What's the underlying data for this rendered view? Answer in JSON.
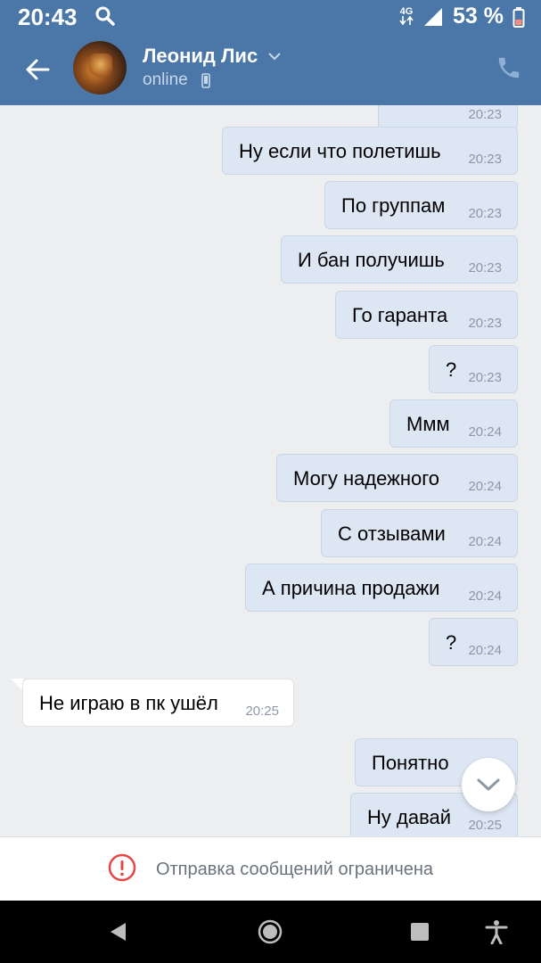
{
  "status_bar": {
    "time": "20:43",
    "network": "4G",
    "battery": "53 %"
  },
  "header": {
    "contact_name": "Леонид Лис",
    "contact_status": "online"
  },
  "messages": [
    {
      "direction": "out",
      "text": "",
      "time": "20:23"
    },
    {
      "direction": "out",
      "text": "Ну если что полетишь",
      "time": "20:23"
    },
    {
      "direction": "out",
      "text": "По группам",
      "time": "20:23"
    },
    {
      "direction": "out",
      "text": "И бан получишь",
      "time": "20:23"
    },
    {
      "direction": "out",
      "text": "Го гаранта",
      "time": "20:23"
    },
    {
      "direction": "out",
      "text": "?",
      "time": "20:23"
    },
    {
      "direction": "out",
      "text": "Ммм",
      "time": "20:24"
    },
    {
      "direction": "out",
      "text": "Могу надежного",
      "time": "20:24"
    },
    {
      "direction": "out",
      "text": "С отзывами",
      "time": "20:24"
    },
    {
      "direction": "out",
      "text": "А причина продажи",
      "time": "20:24"
    },
    {
      "direction": "out",
      "text": "?",
      "time": "20:24"
    },
    {
      "direction": "in",
      "text": "Не играю в пк ушёл",
      "time": "20:25"
    },
    {
      "direction": "out",
      "text": "Понятно",
      "time": ""
    },
    {
      "direction": "out",
      "text": "Ну давай",
      "time": "20:25"
    }
  ],
  "restricted_notice": "Отправка сообщений ограничена",
  "colors": {
    "header": "#4a76a8",
    "outgoing_bubble": "#dde6f3",
    "incoming_bubble": "#ffffff",
    "warning": "#e64646"
  }
}
